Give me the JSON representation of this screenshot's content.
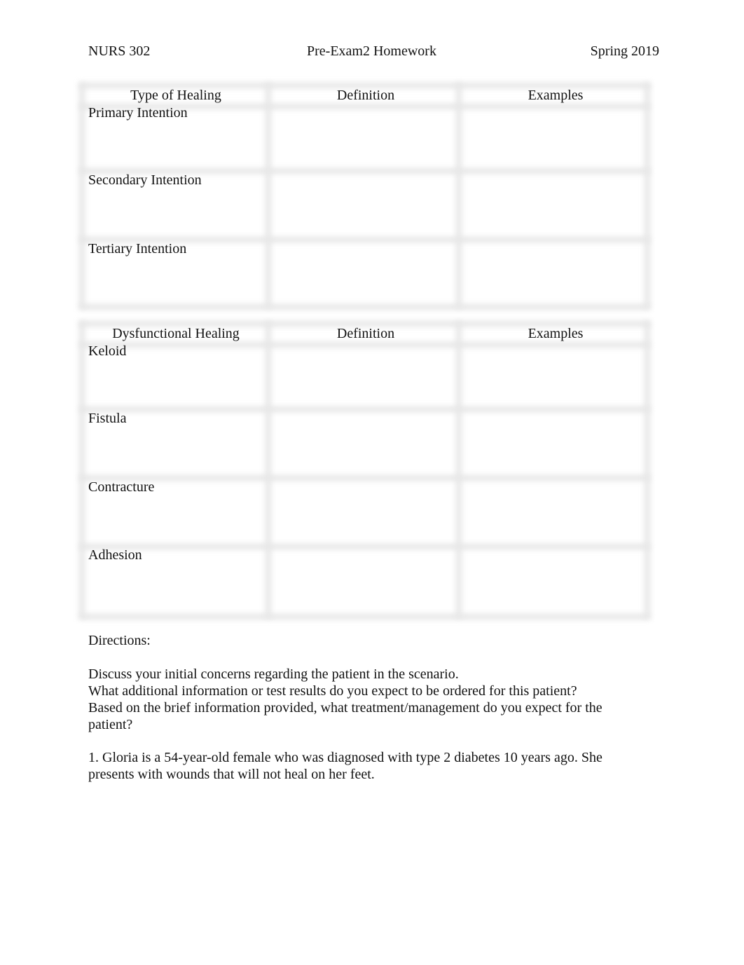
{
  "header": {
    "course": "NURS 302",
    "title": "Pre-Exam2 Homework",
    "term": "Spring 2019"
  },
  "healing_table": {
    "columns": [
      "Type of Healing",
      "Definition",
      "Examples"
    ],
    "rows": [
      {
        "type": "Primary Intention",
        "definition": "",
        "examples": ""
      },
      {
        "type": "Secondary Intention",
        "definition": "",
        "examples": ""
      },
      {
        "type": "Tertiary Intention",
        "definition": "",
        "examples": ""
      }
    ]
  },
  "dysfunctional_table": {
    "columns": [
      "Dysfunctional Healing",
      "Definition",
      "Examples"
    ],
    "rows": [
      {
        "type": "Keloid",
        "definition": "",
        "examples": ""
      },
      {
        "type": "Fistula",
        "definition": "",
        "examples": ""
      },
      {
        "type": "Contracture",
        "definition": "",
        "examples": ""
      },
      {
        "type": "Adhesion",
        "definition": "",
        "examples": ""
      }
    ]
  },
  "directions": {
    "heading": "Directions:",
    "lines": [
      "Discuss your initial concerns regarding the patient in the scenario.",
      "What additional information or test results do you expect to be ordered for this patient?",
      "Based on the brief information provided, what treatment/management do you expect for the patient?"
    ]
  },
  "scenario": {
    "text": "1. Gloria is a 54-year-old female who was diagnosed with type 2 diabetes 10 years ago. She presents with wounds that will not heal on her feet."
  }
}
